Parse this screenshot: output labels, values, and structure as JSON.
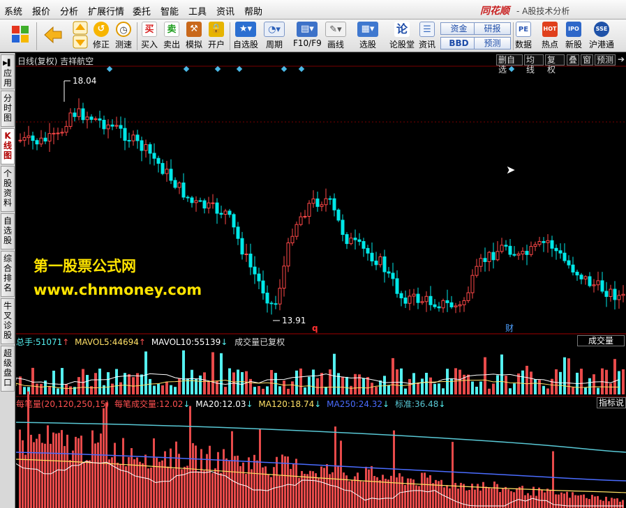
{
  "menubar": {
    "items": [
      "系统",
      "报价",
      "分析",
      "扩展行情",
      "委托",
      "智能",
      "工具",
      "资讯",
      "帮助"
    ],
    "brand": "同花顺",
    "app_subtitle": "- A股技术分析"
  },
  "toolbar": {
    "buttons": [
      {
        "name": "windows-grid-icon",
        "label": ""
      },
      {
        "name": "back-arrow-icon",
        "label": ""
      },
      {
        "name": "up-down-arrows-icon",
        "label": ""
      },
      {
        "name": "fix-icon",
        "label": "修正"
      },
      {
        "name": "stopwatch-icon",
        "label": "测速"
      },
      {
        "name": "buy-icon",
        "label": "买入",
        "glyph": "买"
      },
      {
        "name": "sell-icon",
        "label": "卖出",
        "glyph": "卖"
      },
      {
        "name": "hammer-icon",
        "label": "模拟"
      },
      {
        "name": "lock-icon",
        "label": "开户"
      },
      {
        "name": "star-icon",
        "label": "自选股"
      },
      {
        "name": "clock-icon",
        "label": "周期"
      },
      {
        "name": "f10-icon",
        "label": "F10/F9"
      },
      {
        "name": "pen-icon",
        "label": "画线"
      },
      {
        "name": "select-stock-icon",
        "label": "选股"
      },
      {
        "name": "lun-icon",
        "label": "论股堂",
        "glyph": "论"
      },
      {
        "name": "news-icon",
        "label": "资讯"
      },
      {
        "name": "data-icon",
        "label": "数据",
        "glyph": "PE"
      },
      {
        "name": "hot-icon",
        "label": "热点",
        "glyph": "HOT"
      },
      {
        "name": "ipo-icon",
        "label": "新股",
        "glyph": "IPO"
      },
      {
        "name": "sh-hk-icon",
        "label": "沪港通",
        "glyph": "SSE"
      }
    ],
    "boxes": [
      "资金",
      "研报",
      "BBD",
      "预测"
    ]
  },
  "sidebar": {
    "tabs": [
      {
        "label": "应用",
        "active": false
      },
      {
        "label": "分时图",
        "active": false
      },
      {
        "label": "K线图",
        "active": true
      },
      {
        "label": "个股资料",
        "active": false
      },
      {
        "label": "自选股",
        "active": false
      },
      {
        "label": "综合排名",
        "active": false
      },
      {
        "label": "牛叉诊股",
        "active": false
      },
      {
        "label": "超级盘口",
        "active": false
      }
    ]
  },
  "kline": {
    "title": "日线(复权) 吉祥航空",
    "controls": [
      "删自选",
      "均线",
      "复权",
      "叠",
      "窗",
      "预测"
    ],
    "high_label": "18.04",
    "low_label": "13.91",
    "marker_q": "q",
    "marker_cai": "财"
  },
  "watermark": {
    "line1": "第一股票公式网",
    "line2": "www.chnmoney.com"
  },
  "volume": {
    "total_label": "总手:",
    "total_value": "51071",
    "mavol5_label": "MAVOL5:",
    "mavol5_value": "44694",
    "mavol10_label": "MAVOL10:",
    "mavol10_value": "55139",
    "note": "成交量已复权",
    "right_label": "成交量"
  },
  "pertrade": {
    "name": "每笔量(20,120,250,15)",
    "per_label": "每笔成交量:",
    "per_value": "12.02",
    "ma20_label": "MA20:",
    "ma20_value": "12.03",
    "ma120_label": "MA120:",
    "ma120_value": "18.74",
    "ma250_label": "MA250:",
    "ma250_value": "24.32",
    "std_label": "标准:",
    "std_value": "36.48",
    "right_label": "指标说"
  },
  "colors": {
    "up": "#e74a4a",
    "down": "#54f0f0",
    "price_up": "#ff4848",
    "price_down": "#00e8e8",
    "ma_white": "#ffffff",
    "ma_yellow": "#ffe066",
    "ma_blue": "#4a6cff",
    "ma_cyan": "#59c9d6",
    "grid": "#7a0000",
    "label_red": "#ff5050"
  }
}
